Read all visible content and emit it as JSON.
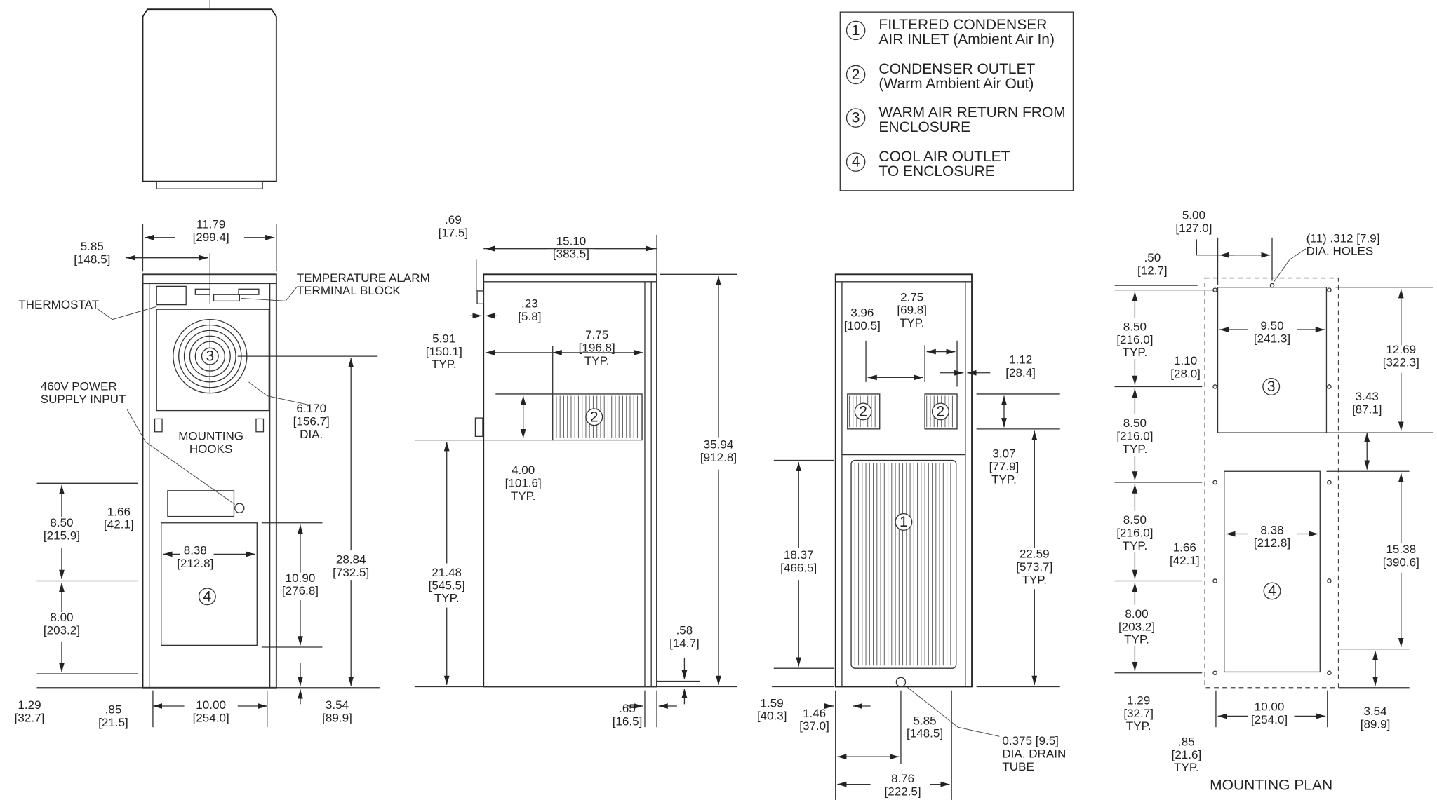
{
  "legend": {
    "items": [
      {
        "num": "1",
        "lines": [
          "FILTERED CONDENSER",
          "AIR INLET (Ambient Air In)"
        ]
      },
      {
        "num": "2",
        "lines": [
          "CONDENSER OUTLET",
          "(Warm Ambient Air Out)"
        ]
      },
      {
        "num": "3",
        "lines": [
          "WARM AIR RETURN FROM",
          "ENCLOSURE"
        ]
      },
      {
        "num": "4",
        "lines": [
          "COOL AIR OUTLET",
          "TO ENCLOSURE"
        ]
      }
    ]
  },
  "labels": {
    "f_width": [
      "11.79",
      "[299.4]"
    ],
    "f_center": [
      "5.85",
      "[148.5]"
    ],
    "f_alarm": [
      "TEMPERATURE ALARM",
      "TERMINAL BLOCK"
    ],
    "f_thermo": [
      "THERMOSTAT"
    ],
    "f_power": [
      "460V POWER",
      "SUPPLY INPUT"
    ],
    "f_hooks": [
      "MOUNTING",
      "HOOKS"
    ],
    "f_fan": [
      "6.170",
      "[156.7]",
      "DIA."
    ],
    "f_2884": [
      "28.84",
      "[732.5]"
    ],
    "f_850": [
      "8.50",
      "[215.9]"
    ],
    "f_166": [
      "1.66",
      "[42.1]"
    ],
    "f_838": [
      "8.38",
      "[212.8]"
    ],
    "f_1090": [
      "10.90",
      "[276.8]"
    ],
    "f_800": [
      "8.00",
      "[203.2]"
    ],
    "f_129": [
      "1.29",
      "[32.7]"
    ],
    "f_085": [
      ".85",
      "[21.5]"
    ],
    "f_1000": [
      "10.00",
      "[254.0]"
    ],
    "f_354": [
      "3.54",
      "[89.9]"
    ],
    "s_069": [
      ".69",
      "[17.5]"
    ],
    "s_1510": [
      "15.10",
      "[383.5]"
    ],
    "s_023": [
      ".23",
      "[5.8]"
    ],
    "s_591": [
      "5.91",
      "[150.1]",
      "TYP."
    ],
    "s_775": [
      "7.75",
      "[196.8]",
      "TYP."
    ],
    "s_400": [
      "4.00",
      "[101.6]",
      "TYP."
    ],
    "s_3594": [
      "35.94",
      "[912.8]"
    ],
    "s_2148": [
      "21.48",
      "[545.5]",
      "TYP."
    ],
    "s_058": [
      ".58",
      "[14.7]"
    ],
    "s_065": [
      ".65",
      "[16.5]"
    ],
    "r_396": [
      "3.96",
      "[100.5]"
    ],
    "r_275": [
      "2.75",
      "[69.8]",
      "TYP."
    ],
    "r_112": [
      "1.12",
      "[28.4]"
    ],
    "r_307": [
      "3.07",
      "[77.9]",
      "TYP."
    ],
    "r_1837": [
      "18.37",
      "[466.5]"
    ],
    "r_2259": [
      "22.59",
      "[573.7]",
      "TYP."
    ],
    "r_159": [
      "1.59",
      "[40.3]"
    ],
    "r_146": [
      "1.46",
      "[37.0]"
    ],
    "r_585": [
      "5.85",
      "[148.5]"
    ],
    "r_drain": [
      "0.375 [9.5]",
      "DIA. DRAIN",
      "TUBE"
    ],
    "r_876": [
      "8.76",
      "[222.5]"
    ],
    "m_500": [
      "5.00",
      "[127.0]"
    ],
    "m_holes": [
      "(11) .312 [7.9]",
      "DIA. HOLES"
    ],
    "m_050": [
      ".50",
      "[12.7]"
    ],
    "m_850a": [
      "8.50",
      "[216.0]",
      "TYP."
    ],
    "m_950": [
      "9.50",
      "[241.3]"
    ],
    "m_110": [
      "1.10",
      "[28.0]"
    ],
    "m_1269": [
      "12.69",
      "[322.3]"
    ],
    "m_343": [
      "3.43",
      "[87.1]"
    ],
    "m_850b": [
      "8.50",
      "[216.0]",
      "TYP."
    ],
    "m_838": [
      "8.38",
      "[212.8]"
    ],
    "m_850c": [
      "8.50",
      "[216.0]",
      "TYP."
    ],
    "m_166": [
      "1.66",
      "[42.1]"
    ],
    "m_1538": [
      "15.38",
      "[390.6]"
    ],
    "m_800": [
      "8.00",
      "[203.2]",
      "TYP."
    ],
    "m_129": [
      "1.29",
      "[32.7]",
      "TYP."
    ],
    "m_1000": [
      "10.00",
      "[254.0]"
    ],
    "m_354": [
      "3.54",
      "[89.9]"
    ],
    "m_085": [
      ".85",
      "[21.6]",
      "TYP."
    ]
  },
  "mounting_plan_title": "MOUNTING PLAN",
  "callouts": {
    "front_3": "3",
    "front_4": "4",
    "side_2": "2",
    "rear_2a": "2",
    "rear_2b": "2",
    "rear_1": "1",
    "plan_3": "3",
    "plan_4": "4"
  }
}
